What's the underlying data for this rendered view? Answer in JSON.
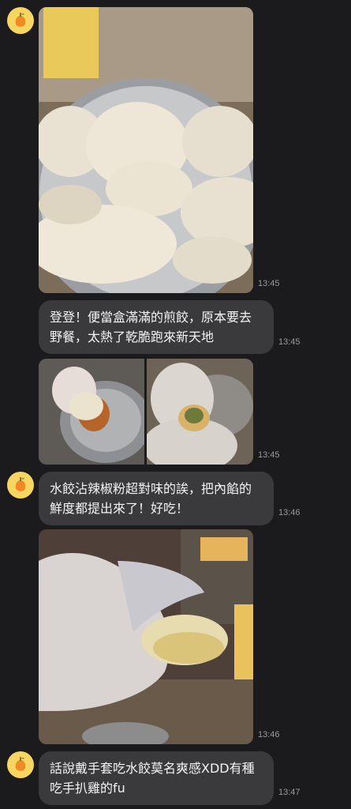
{
  "messages": [
    {
      "type": "image",
      "time": "13:45",
      "alt_icon": "dumplings-photo"
    },
    {
      "type": "text",
      "text": "登登！便當盒滿滿的煎餃，原本要去野餐，太熱了乾脆跑來新天地",
      "time": "13:45"
    },
    {
      "type": "image-pair",
      "time": "13:45"
    },
    {
      "type": "text",
      "text": "水餃沾辣椒粉超對味的誒，把內餡的鮮度都提出來了！好吃！",
      "time": "13:46"
    },
    {
      "type": "image",
      "time": "13:46"
    },
    {
      "type": "text",
      "text": "話說戴手套吃水餃莫名爽感XDD有種吃手扒雞的fu",
      "time": "13:47"
    }
  ],
  "colors": {
    "background": "#1b1b1d",
    "bubble": "#3a3a3c",
    "avatar": "#f6d561",
    "avatar_fruit": "#f08a24"
  }
}
